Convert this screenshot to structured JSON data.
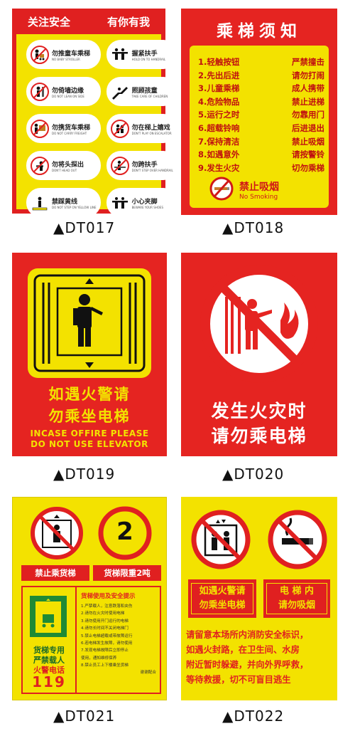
{
  "colors": {
    "red": "#e52421",
    "yellow": "#f3e200",
    "white": "#ffffff"
  },
  "dt017": {
    "header_left": "关注安全",
    "header_right": "有你有我",
    "items": [
      {
        "zh": "勿推童车乘梯",
        "en": "NO BABY STROLLER",
        "icon": "stroller-icon"
      },
      {
        "zh": "握紧扶手",
        "en": "HOLD ON TO HANDRAIL",
        "icon": "hold-handrail-icon"
      },
      {
        "zh": "勿倚墙边缘",
        "en": "DO NOT LEAN ON SIDE",
        "icon": "lean-side-icon"
      },
      {
        "zh": "照顾孩童",
        "en": "TAKE CARE OF CHILDREN",
        "icon": "child-care-icon"
      },
      {
        "zh": "勿携货车乘梯",
        "en": "DO NOT CARRY FREIGHT",
        "icon": "freight-cart-icon"
      },
      {
        "zh": "勿在梯上嬉戏",
        "en": "DON'T PLAY ON ESCALATOR",
        "icon": "no-play-icon"
      },
      {
        "zh": "勿将头探出",
        "en": "DON'T HEAD OUT",
        "icon": "head-out-icon"
      },
      {
        "zh": "勿跨扶手",
        "en": "DON'T STEP OVER HANDRAIL",
        "icon": "no-climb-handrail-icon"
      },
      {
        "zh": "禁踩黄线",
        "en": "DO NOT STEP ON YELLOW LINE",
        "icon": "yellow-line-icon"
      },
      {
        "zh": "小心夹脚",
        "en": "BEWARE YOUR SHOES",
        "icon": "foot-pinch-icon"
      }
    ]
  },
  "dt018": {
    "title": "乘梯须知",
    "rules": [
      [
        "1.轻触按钮",
        "严禁撞击"
      ],
      [
        "2.先出后进",
        "请勿打闹"
      ],
      [
        "3.儿童乘梯",
        "成人携带"
      ],
      [
        "4.危险物品",
        "禁止进梯"
      ],
      [
        "5.运行之时",
        "勿靠用门"
      ],
      [
        "6.超载铃响",
        "后进退出"
      ],
      [
        "7.保持清洁",
        "禁止吸烟"
      ],
      [
        "8.如遇意外",
        "请按警铃"
      ],
      [
        "9.发生火灾",
        "切勿乘梯"
      ]
    ],
    "no_smoking_zh": "禁止吸烟",
    "no_smoking_en": "No Smoking"
  },
  "dt019": {
    "line1": "如遇火警请",
    "line2": "勿乘坐电梯",
    "en_line1": "INCASE OFFIRE PLEASE",
    "en_line2": "DO NOT USE ELEVATOR"
  },
  "dt020": {
    "line1": "发生火灾时",
    "line2": "请勿乘电梯"
  },
  "dt021": {
    "tag_left": "禁止乘货梯",
    "tag_right": "货梯限重2吨",
    "limit_number": "2",
    "left_line1": "货梯专用",
    "left_line2": "严禁载人",
    "left_line3": "火警电话",
    "fire_number": "119",
    "tips_title": "货梯使用及安全提示",
    "tips": [
      "1.严禁载人，注意跌落和夹伤",
      "2.请勿在火灾时使用电梯",
      "3.请勿使用开门运行的电梯",
      "4.请勿长时间不关闭电梯门",
      "5.禁止电梯超载或带故障运行",
      "6.若电梯发生故障，请勿使用",
      "7.发现电梯故障后立即停止",
      "   使用，通知维修保养",
      "8.禁止员工上下楼乘坐货梯"
    ],
    "tips_sign": "谢谢配合"
  },
  "dt022": {
    "box_left_1": "如遇火警请",
    "box_left_2": "勿乘坐电梯",
    "box_right_1": "电 梯 内",
    "box_right_2": "请勿吸烟",
    "paragraph": [
      "请留意本场所内消防安全标识，",
      "如遇火封路，在卫生间、水房",
      "附近暂时躲避，并向外界呼救，",
      "等待救援，切不可盲目逃生"
    ]
  },
  "captions": {
    "dt017": "▲DT017",
    "dt018": "▲DT018",
    "dt019": "▲DT019",
    "dt020": "▲DT020",
    "dt021": "▲DT021",
    "dt022": "▲DT022"
  }
}
